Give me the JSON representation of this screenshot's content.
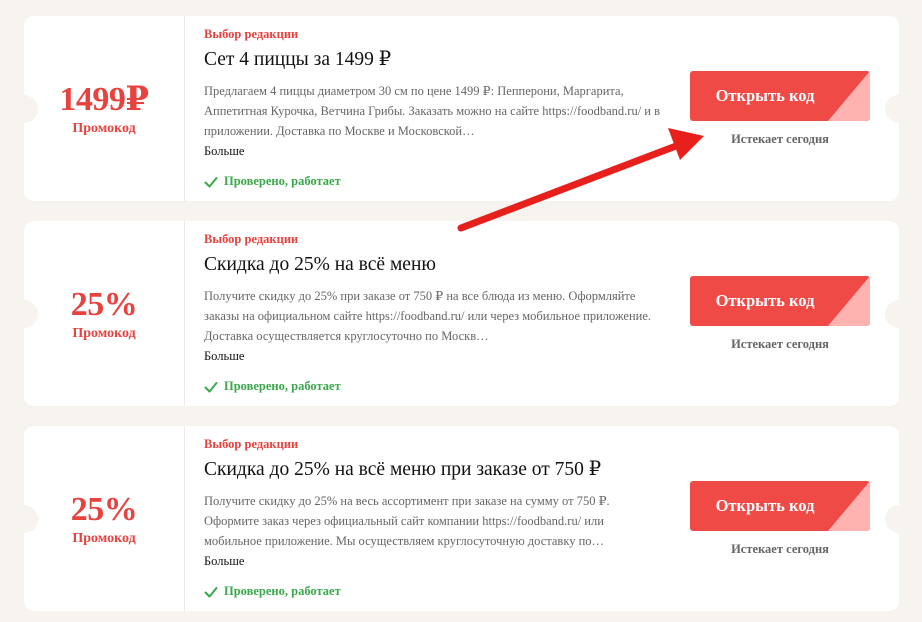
{
  "coupons": [
    {
      "discount": "1499₽",
      "discount_type": "Промокод",
      "editor_badge": "Выбор редакции",
      "title": "Сет 4 пиццы за 1499 ₽",
      "description": "Предлагаем 4 пиццы диаметром 30 см по цене 1499 ₽: Пепперони, Маргарита, Аппетитная Курочка, Ветчина Грибы. Заказать можно на сайте https://foodband.ru/ и в приложении. Доставка по Москве и Московской…",
      "more_label": "Больше",
      "verified_label": "Проверено, работает",
      "button_label": "Открыть код",
      "expires_label": "Истекает сегодня"
    },
    {
      "discount": "25%",
      "discount_type": "Промокод",
      "editor_badge": "Выбор редакции",
      "title": "Скидка до 25% на всё меню",
      "description": "Получите скидку до 25% при заказе от 750 ₽ на все блюда из меню. Оформляйте заказы на официальном сайте https://foodband.ru/ или через мобильное приложение. Доставка осуществляется круглосуточно по Москв…",
      "more_label": "Больше",
      "verified_label": "Проверено, работает",
      "button_label": "Открыть код",
      "expires_label": "Истекает сегодня"
    },
    {
      "discount": "25%",
      "discount_type": "Промокод",
      "editor_badge": "Выбор редакции",
      "title": "Скидка до 25% на всё меню при заказе от 750 ₽",
      "description": "Получите скидку до 25% на весь ассортимент при заказе на сумму от 750 ₽. Оформите заказ через официальный сайт компании https://foodband.ru/ или мобильное приложение. Мы осуществляем круглосуточную доставку по…",
      "more_label": "Больше",
      "verified_label": "Проверено, работает",
      "button_label": "Открыть код",
      "expires_label": "Истекает сегодня"
    }
  ],
  "colors": {
    "accent": "#e8423f",
    "button": "#f04a47",
    "verified": "#3aa84a",
    "arrow": "#e8201c"
  },
  "icons": {
    "verified": "check-icon",
    "annotation": "arrow-icon"
  }
}
